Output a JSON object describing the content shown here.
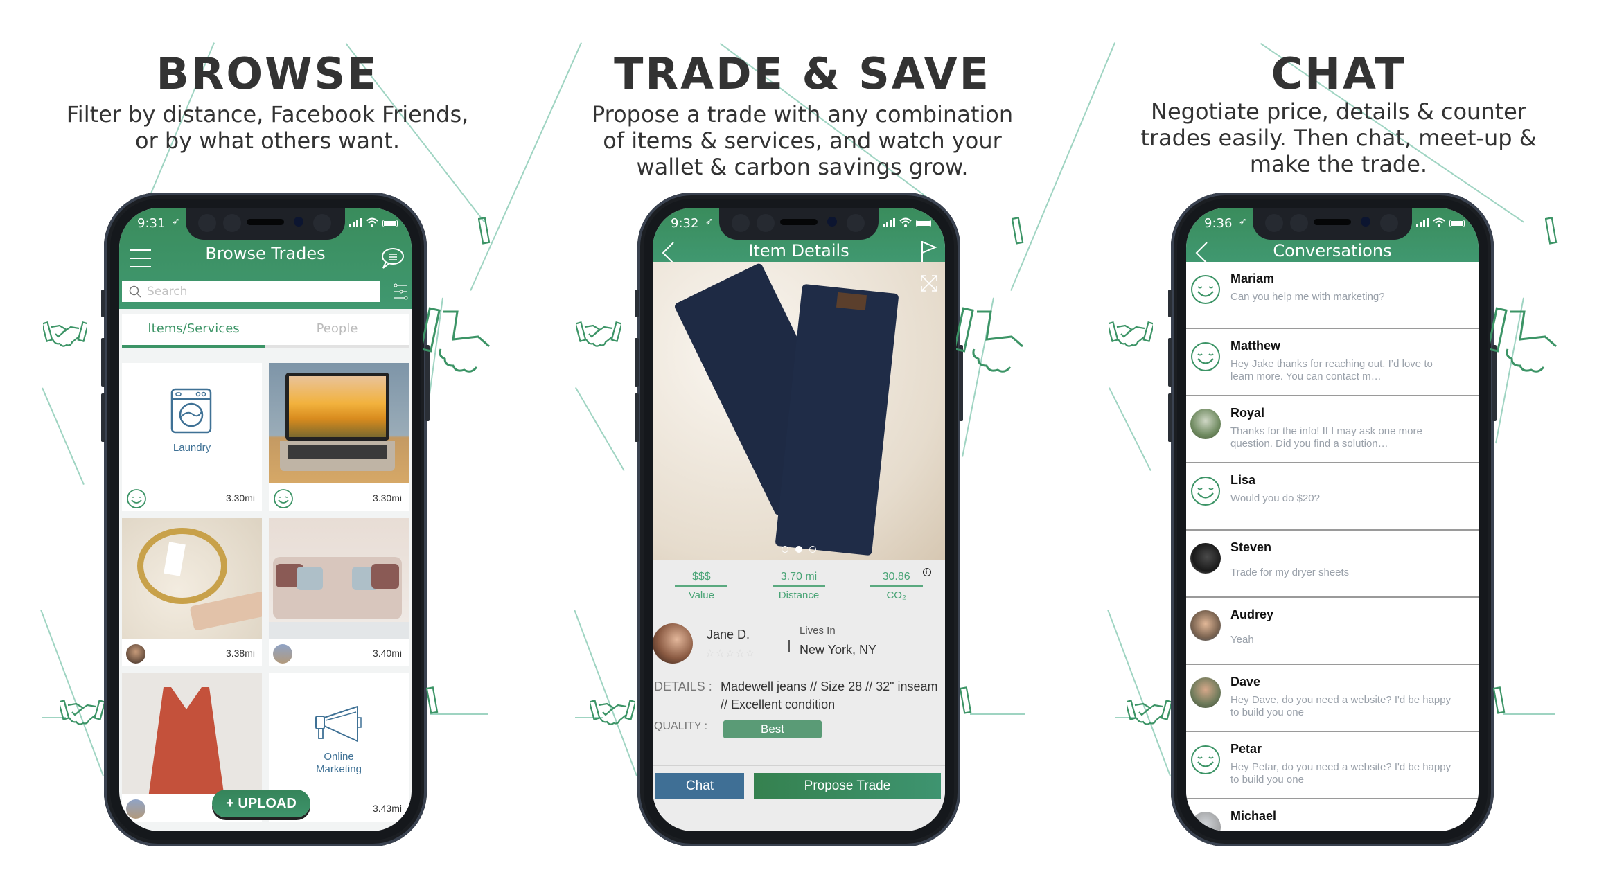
{
  "colors": {
    "brand_green": "#3c9466",
    "header_green": "#3a8c5c",
    "chat_blue": "#3f6f95",
    "service_blue": "#3f7195",
    "text_dark": "#333333",
    "muted": "#9aa1aa"
  },
  "panels": [
    {
      "title": "BROWSE",
      "subtitle": "Filter by distance, Facebook Friends,\nor by what others want.",
      "screen": {
        "status_time": "9:31",
        "header_title": "Browse Trades",
        "left_icon": "hamburger-menu-icon",
        "right_icon": "chat-bubble-icon",
        "search_placeholder": "Search",
        "filter_icon": "sliders-icon",
        "tabs": [
          {
            "label": "Items/Services",
            "active": true
          },
          {
            "label": "People",
            "active": false
          }
        ],
        "cards": [
          {
            "type": "service",
            "label": "Laundry",
            "icon": "washing-machine-icon",
            "owner": "smiley-avatar",
            "distance": "3.30mi"
          },
          {
            "type": "photo",
            "subject": "laptop",
            "owner": "smiley-avatar",
            "distance": "3.30mi"
          },
          {
            "type": "photo",
            "subject": "gold bracelet",
            "owner": "user-avatar",
            "distance": "3.38mi"
          },
          {
            "type": "photo",
            "subject": "sofa",
            "owner": "user-avatar",
            "distance": "3.40mi"
          },
          {
            "type": "photo",
            "subject": "red top",
            "owner": "user-avatar",
            "distance": ""
          },
          {
            "type": "service",
            "label": "Online\nMarketing",
            "icon": "megaphone-icon",
            "owner": "user-avatar",
            "distance": "3.43mi"
          }
        ],
        "upload_label": "+ UPLOAD"
      }
    },
    {
      "title": "TRADE & SAVE",
      "subtitle": "Propose a trade with any combination\nof items & services, and watch your\nwallet & carbon savings grow.",
      "screen": {
        "status_time": "9:32",
        "header_title": "Item Details",
        "photo_pages": 3,
        "photo_current_page": 2,
        "stats": [
          {
            "value": "$$$",
            "label": "Value"
          },
          {
            "value": "3.70 mi",
            "label": "Distance"
          },
          {
            "value": "30.86",
            "label": "CO₂"
          }
        ],
        "seller_name": "Jane D.",
        "seller_rating": 0,
        "seller_rating_max": 5,
        "stars_text": "☆☆☆☆☆",
        "lives_in_label": "Lives In",
        "lives_in_value": "New York, NY",
        "details_label": "DETAILS :",
        "details_value": "Madewell jeans // Size 28 // 32\" inseam // Excellent condition",
        "quality_label": "QUALITY :",
        "quality_value": "Best",
        "chat_button": "Chat",
        "propose_button": "Propose Trade"
      }
    },
    {
      "title": "CHAT",
      "subtitle": "Negotiate price, details & counter\ntrades easily. Then chat, meet-up &\nmake the trade.",
      "screen": {
        "status_time": "9:36",
        "header_title": "Conversations",
        "conversations": [
          {
            "name": "Mariam",
            "message": "Can you help me with marketing?",
            "avatar": "smiley"
          },
          {
            "name": "Matthew",
            "message": "Hey Jake thanks for reaching out. I’d love to learn more. You can contact m…",
            "avatar": "smiley"
          },
          {
            "name": "Royal",
            "message": "Thanks for the info! If I may ask one more question. Did you find a solution…",
            "avatar": "photo"
          },
          {
            "name": "Lisa",
            "message": "Would you do $20?",
            "avatar": "smiley"
          },
          {
            "name": "Steven",
            "message": "Trade for my dryer sheets",
            "avatar": "photo"
          },
          {
            "name": "Audrey",
            "message": "Yeah",
            "avatar": "photo"
          },
          {
            "name": "Dave",
            "message": "Hey Dave, do you need a website? I'd be happy to build you one",
            "avatar": "photo"
          },
          {
            "name": "Petar",
            "message": "Hey Petar, do you need a website? I'd be happy to build you one",
            "avatar": "smiley"
          },
          {
            "name": "Michael",
            "message": "",
            "avatar": "photo"
          }
        ]
      }
    }
  ]
}
